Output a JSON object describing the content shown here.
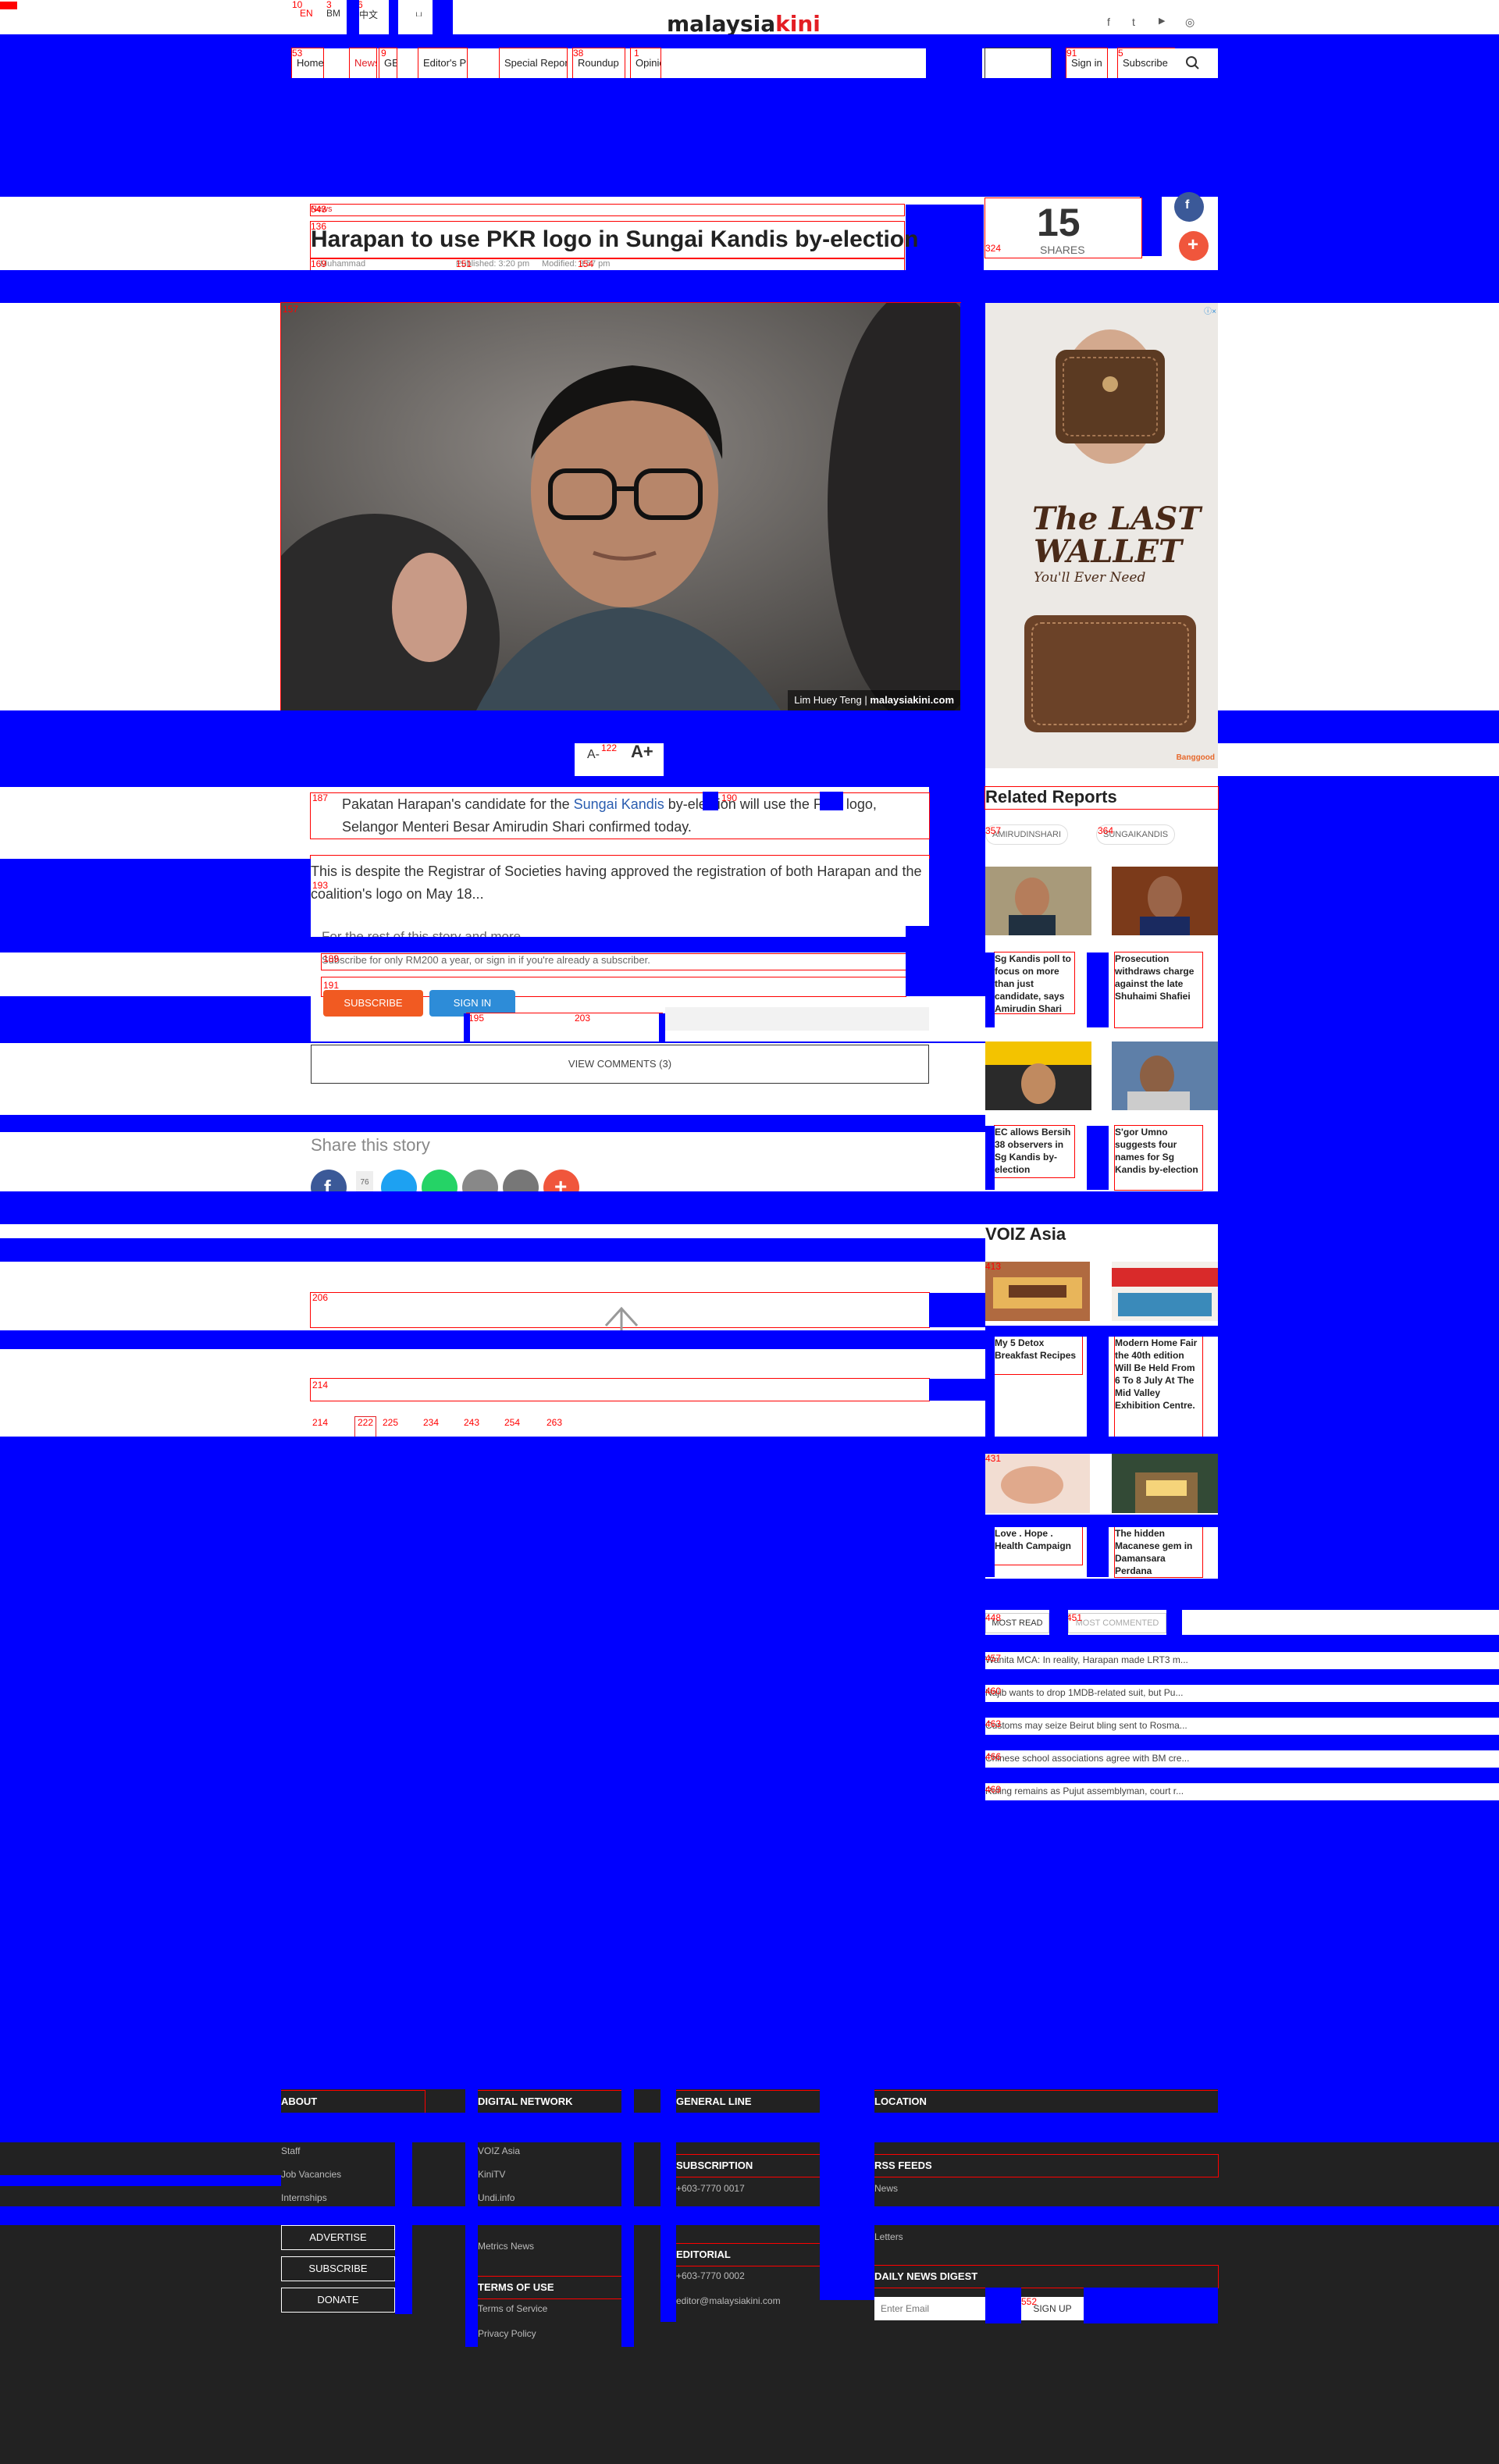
{
  "header": {
    "lang": [
      "EN",
      "BM",
      "中文",
      "ப"
    ],
    "logo_left": "malaysia",
    "logo_right": "kini",
    "social": [
      "f",
      "t",
      "▶",
      "◎"
    ],
    "nav": [
      "Home",
      "News",
      "GE",
      "Editor's Picks",
      "Special Reports",
      "Roundup",
      "Opinion"
    ],
    "signin": "Sign in",
    "subscribe": "Subscribe",
    "search_icon": "search-icon"
  },
  "article": {
    "section": "News",
    "title": "Harapan to use PKR logo in Sungai Kandis by-election",
    "author": "Muhammad",
    "published": "Published: 3:20 pm",
    "modified": "Modified: 3:57 pm",
    "shares_count": "15",
    "shares_label": "SHARES",
    "image_credit_name": "Lim Huey Teng",
    "image_credit_site": "malaysiakini.com",
    "font_minus": "A-",
    "font_plus": "A+",
    "para1_pre": "Pakatan Harapan's candidate for the ",
    "para1_link": "Sungai Kandis",
    "para1_post": " by-election will use the PKR logo, Selangor Menteri Besar Amirudin Shari confirmed today.",
    "para2": "This is despite the Registrar of Societies having approved the registration of both Harapan and the coalition's logo on May 18...",
    "paywall_title": "For the rest of this story and more",
    "paywall_text": "Subscribe for only RM200 a year, or sign in if you're already a subscriber.",
    "subscribe_btn": "SUBSCRIBE",
    "signin_btn": "SIGN IN",
    "view_comments": "VIEW COMMENTS (3)",
    "share_story": "Share this story",
    "share_count": "76",
    "colors": {
      "subscribe": "#f15a22",
      "signin": "#2d8cd8",
      "link": "#2a5db0"
    }
  },
  "ad": {
    "title_line1": "The LAST",
    "title_line2": "WALLET",
    "subtitle": "You'll Ever Need",
    "brand": "Banggood"
  },
  "related": {
    "heading": "Related Reports",
    "tags": [
      "AMIRUDINSHARI",
      "SUNGAIKANDIS"
    ],
    "items": [
      "Sg Kandis poll to focus on more than just candidate, says Amirudin Shari",
      "Prosecution withdraws charge against the late Shuhaimi Shafiei",
      "EC allows Bersih 38 observers in Sg Kandis by-election",
      "S'gor Umno suggests four names for Sg Kandis by-election"
    ]
  },
  "voiz": {
    "heading": "VOIZ Asia",
    "items": [
      "My 5 Detox Breakfast Recipes",
      "Modern Home Fair the 40th edition Will Be Held From 6 To 8 July At The Mid Valley Exhibition Centre.",
      "Love . Hope . Health Campaign",
      "The hidden Macanese gem in Damansara Perdana"
    ]
  },
  "most": {
    "tabs": [
      "MOST READ",
      "MOST COMMENTED"
    ],
    "items": [
      "Wanita MCA: In reality, Harapan made LRT3 m...",
      "Najib wants to drop 1MDB-related suit, but Pu...",
      "Customs may seize Beirut bling sent to Rosma...",
      "Chinese school associations agree with BM cre...",
      "Ruling remains as Pujut assemblyman, court r..."
    ]
  },
  "pagination": [
    "222",
    "225",
    "234",
    "243",
    "254",
    "263"
  ],
  "footer": {
    "about": "ABOUT",
    "digital": "DIGITAL NETWORK",
    "general": "GENERAL LINE",
    "location": "LOCATION",
    "about_links": [
      "Staff",
      "Job Vacancies",
      "Internships"
    ],
    "digital_links": [
      "VOIZ Asia",
      "KiniTV",
      "Undi.info",
      "Metrics News"
    ],
    "advertise": "ADVERTISE",
    "subscribe": "SUBSCRIBE",
    "donate": "DONATE",
    "subscription": "SUBSCRIPTION",
    "sub_phone": "+603-7770 0017",
    "editorial": "EDITORIAL",
    "ed_phone": "+603-7770 0002",
    "ed_email": "editor@malaysiakini.com",
    "rss": "RSS FEEDS",
    "rss_links": [
      "News",
      "Letters"
    ],
    "terms_head": "TERMS OF USE",
    "terms_links": [
      "Terms of Service",
      "Privacy Policy"
    ],
    "digest": "DAILY NEWS DIGEST",
    "email_placeholder": "Enter Email",
    "signup": "SIGN UP"
  },
  "labels": {
    "top": [
      "10",
      "3",
      "6"
    ],
    "nav": [
      "53",
      "9",
      "38",
      "1",
      "91",
      "5"
    ],
    "article": [
      "543",
      "136",
      "169",
      "151",
      "154",
      "157",
      "187",
      "190",
      "193",
      "189",
      "191",
      "195",
      "203",
      "206",
      "214",
      "122",
      "324"
    ],
    "side": [
      "357",
      "364",
      "413",
      "431",
      "448",
      "451"
    ],
    "lines": [
      "457",
      "460",
      "463",
      "466",
      "469"
    ],
    "page": [
      "552"
    ]
  }
}
